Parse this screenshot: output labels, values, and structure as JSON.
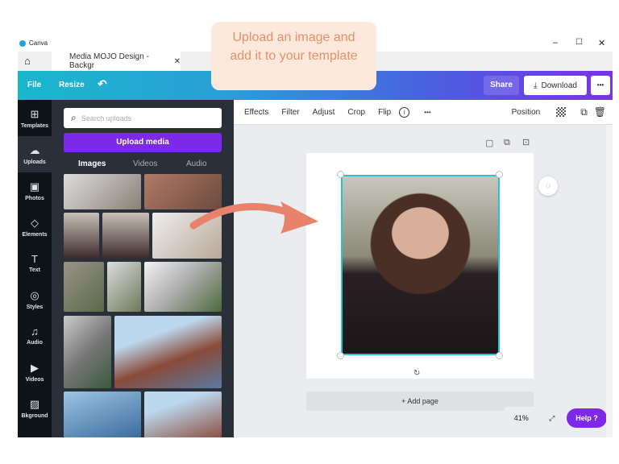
{
  "window": {
    "app_name": "Canva",
    "minimize": "–",
    "maximize": "☐",
    "close": "✕"
  },
  "tab": {
    "title": "Media MOJO Design - Backgr",
    "close": "✕"
  },
  "topbar": {
    "file": "File",
    "resize": "Resize",
    "undo": "↶",
    "share": "Share",
    "download": "Download",
    "more": "•••"
  },
  "sidebar": {
    "items": [
      {
        "label": "Templates",
        "icon": "⊞"
      },
      {
        "label": "Uploads",
        "icon": "☁"
      },
      {
        "label": "Photos",
        "icon": "▣"
      },
      {
        "label": "Elements",
        "icon": "◇"
      },
      {
        "label": "Text",
        "icon": "T"
      },
      {
        "label": "Styles",
        "icon": "◎"
      },
      {
        "label": "Audio",
        "icon": "♫"
      },
      {
        "label": "Videos",
        "icon": "▶"
      },
      {
        "label": "Bkground",
        "icon": "▨"
      }
    ]
  },
  "panel": {
    "search_placeholder": "Search uploads",
    "upload_button": "Upload media",
    "tabs": [
      "Images",
      "Videos",
      "Audio"
    ]
  },
  "toolbar": {
    "items": [
      "Effects",
      "Filter",
      "Adjust",
      "Crop",
      "Flip"
    ],
    "info": "i",
    "more": "•••",
    "position": "Position"
  },
  "canvas": {
    "add_page": "+ Add page",
    "zoom": "41%",
    "help": "Help ?"
  },
  "callout": {
    "text": "Upload an image and add it to your template",
    "bg": "#fde9dc",
    "color": "#e3906c"
  },
  "colors": {
    "accent": "#7d2ae8",
    "arrow": "#e8826a"
  }
}
